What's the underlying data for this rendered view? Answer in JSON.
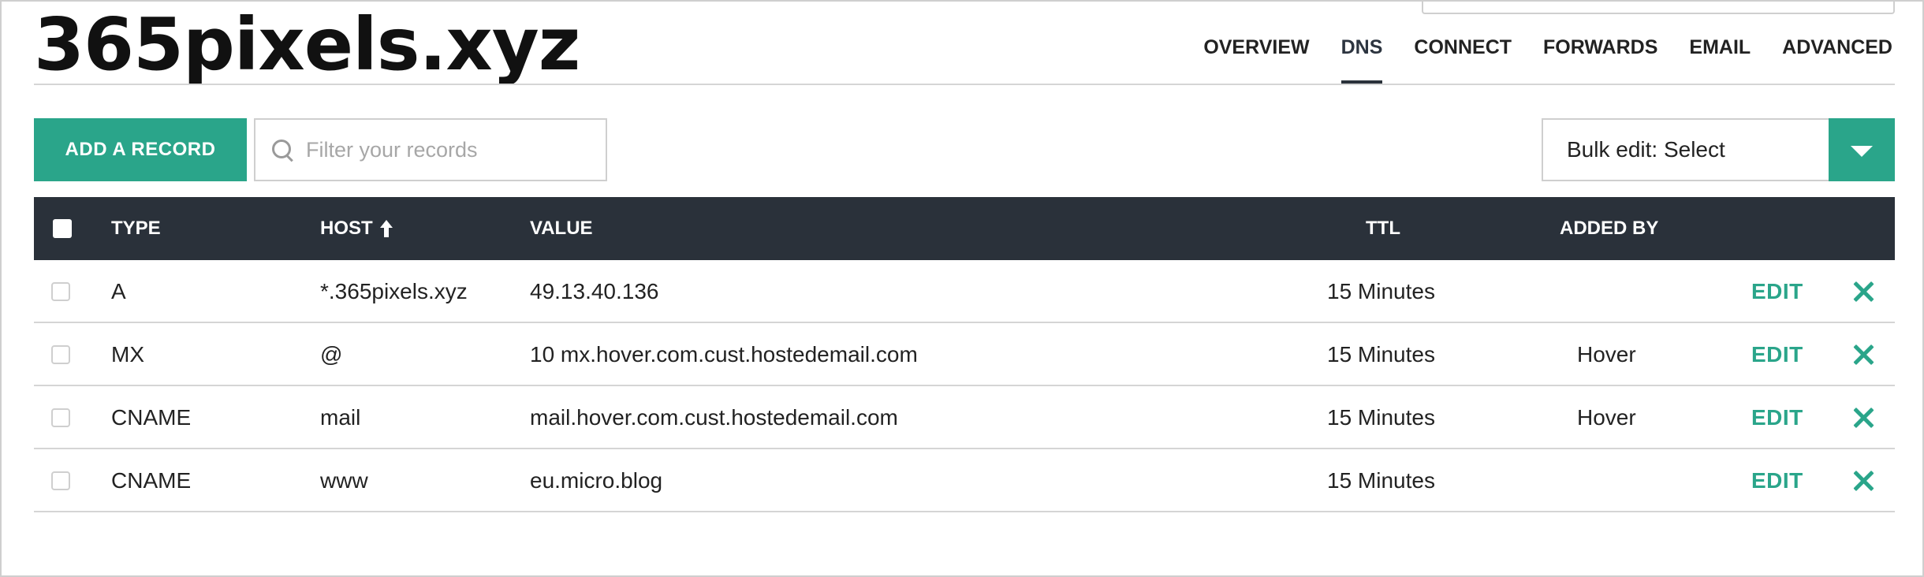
{
  "domain": {
    "title": "365pixels.xyz"
  },
  "nav": {
    "tabs": [
      {
        "label": "OVERVIEW"
      },
      {
        "label": "DNS",
        "active": true
      },
      {
        "label": "CONNECT"
      },
      {
        "label": "FORWARDS"
      },
      {
        "label": "EMAIL"
      },
      {
        "label": "ADVANCED"
      }
    ]
  },
  "toolbar": {
    "add_label": "ADD A RECORD",
    "filter_placeholder": "Filter your records",
    "filter_value": "",
    "bulk_label": "Bulk edit: Select",
    "search_icon": "search-icon",
    "dropdown_icon": "chevron-down-icon"
  },
  "table": {
    "headers": {
      "type": "TYPE",
      "host": "HOST",
      "value": "VALUE",
      "ttl": "TTL",
      "added_by": "ADDED BY"
    },
    "host_sort_icon": "arrow-up-icon",
    "rows": [
      {
        "type": "A",
        "host": "*.365pixels.xyz",
        "value": "49.13.40.136",
        "ttl": "15 Minutes",
        "added_by": "",
        "edit": "EDIT"
      },
      {
        "type": "MX",
        "host": "@",
        "value": "10 mx.hover.com.cust.hostedemail.com",
        "ttl": "15 Minutes",
        "added_by": "Hover",
        "edit": "EDIT"
      },
      {
        "type": "CNAME",
        "host": "mail",
        "value": "mail.hover.com.cust.hostedemail.com",
        "ttl": "15 Minutes",
        "added_by": "Hover",
        "edit": "EDIT"
      },
      {
        "type": "CNAME",
        "host": "www",
        "value": "eu.micro.blog",
        "ttl": "15 Minutes",
        "added_by": "",
        "edit": "EDIT"
      }
    ]
  },
  "colors": {
    "accent": "#2aa58a",
    "header_bg": "#2a313a",
    "border": "#d5d5d5"
  }
}
